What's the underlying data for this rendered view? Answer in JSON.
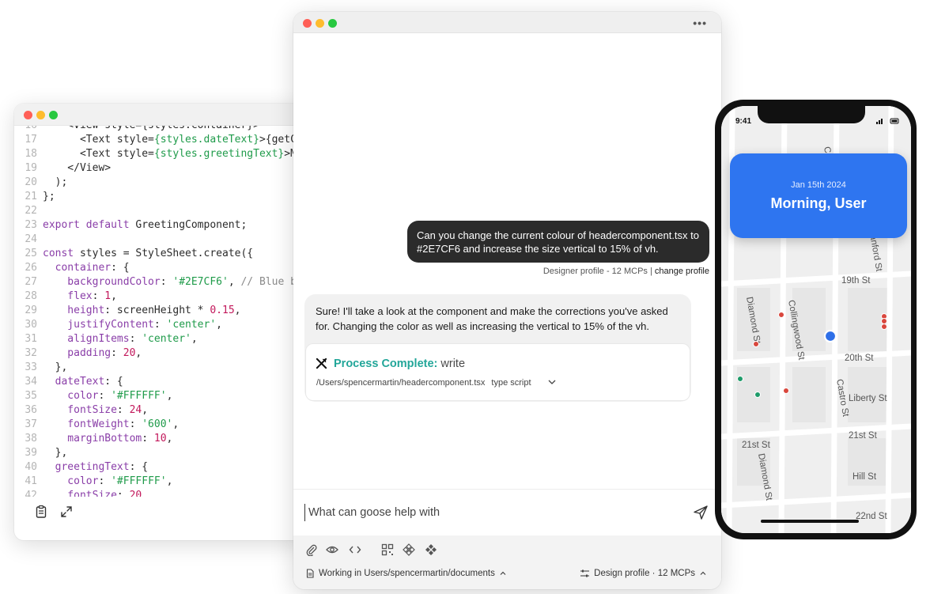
{
  "editor": {
    "lines": [
      {
        "n": "16",
        "segs": [
          [
            "txt",
            "    <View style={styles.container}>"
          ]
        ]
      },
      {
        "n": "17",
        "segs": [
          [
            "txt",
            "      <Text style="
          ],
          [
            "t-str",
            "{styles.dateText}"
          ],
          [
            "txt",
            ">{getC"
          ]
        ]
      },
      {
        "n": "18",
        "segs": [
          [
            "txt",
            "      <Text style="
          ],
          [
            "t-str",
            "{styles.greetingText}"
          ],
          [
            "txt",
            ">M"
          ]
        ]
      },
      {
        "n": "19",
        "segs": [
          [
            "txt",
            "    </View>"
          ]
        ]
      },
      {
        "n": "20",
        "segs": [
          [
            "txt",
            "  );"
          ]
        ]
      },
      {
        "n": "21",
        "segs": [
          [
            "txt",
            "};"
          ]
        ]
      },
      {
        "n": "22",
        "segs": [
          [
            "txt",
            ""
          ]
        ]
      },
      {
        "n": "23",
        "segs": [
          [
            "t-kw",
            "export default "
          ],
          [
            "txt",
            "GreetingComponent;"
          ]
        ]
      },
      {
        "n": "24",
        "segs": [
          [
            "txt",
            ""
          ]
        ]
      },
      {
        "n": "25",
        "segs": [
          [
            "t-kw",
            "const "
          ],
          [
            "txt",
            "styles = StyleSheet.create({"
          ]
        ]
      },
      {
        "n": "26",
        "segs": [
          [
            "t-prop",
            "  container"
          ],
          [
            "txt",
            ": {"
          ]
        ]
      },
      {
        "n": "27",
        "segs": [
          [
            "t-prop",
            "    backgroundColor"
          ],
          [
            "txt",
            ": "
          ],
          [
            "t-str",
            "'#2E7CF6'"
          ],
          [
            "txt",
            ", "
          ],
          [
            "t-cm",
            "// Blue b"
          ]
        ]
      },
      {
        "n": "28",
        "segs": [
          [
            "t-prop",
            "    flex"
          ],
          [
            "txt",
            ": "
          ],
          [
            "t-num",
            "1"
          ],
          [
            "txt",
            ","
          ]
        ]
      },
      {
        "n": "29",
        "segs": [
          [
            "t-prop",
            "    height"
          ],
          [
            "txt",
            ": screenHeight * "
          ],
          [
            "t-num",
            "0.15"
          ],
          [
            "txt",
            ","
          ]
        ]
      },
      {
        "n": "30",
        "segs": [
          [
            "t-prop",
            "    justifyContent"
          ],
          [
            "txt",
            ": "
          ],
          [
            "t-str",
            "'center'"
          ],
          [
            "txt",
            ","
          ]
        ]
      },
      {
        "n": "31",
        "segs": [
          [
            "t-prop",
            "    alignItems"
          ],
          [
            "txt",
            ": "
          ],
          [
            "t-str",
            "'center'"
          ],
          [
            "txt",
            ","
          ]
        ]
      },
      {
        "n": "32",
        "segs": [
          [
            "t-prop",
            "    padding"
          ],
          [
            "txt",
            ": "
          ],
          [
            "t-num",
            "20"
          ],
          [
            "txt",
            ","
          ]
        ]
      },
      {
        "n": "33",
        "segs": [
          [
            "txt",
            "  },"
          ]
        ]
      },
      {
        "n": "34",
        "segs": [
          [
            "t-prop",
            "  dateText"
          ],
          [
            "txt",
            ": {"
          ]
        ]
      },
      {
        "n": "35",
        "segs": [
          [
            "t-prop",
            "    color"
          ],
          [
            "txt",
            ": "
          ],
          [
            "t-str",
            "'#FFFFFF'"
          ],
          [
            "txt",
            ","
          ]
        ]
      },
      {
        "n": "36",
        "segs": [
          [
            "t-prop",
            "    fontSize"
          ],
          [
            "txt",
            ": "
          ],
          [
            "t-num",
            "24"
          ],
          [
            "txt",
            ","
          ]
        ]
      },
      {
        "n": "37",
        "segs": [
          [
            "t-prop",
            "    fontWeight"
          ],
          [
            "txt",
            ": "
          ],
          [
            "t-str",
            "'600'"
          ],
          [
            "txt",
            ","
          ]
        ]
      },
      {
        "n": "38",
        "segs": [
          [
            "t-prop",
            "    marginBottom"
          ],
          [
            "txt",
            ": "
          ],
          [
            "t-num",
            "10"
          ],
          [
            "txt",
            ","
          ]
        ]
      },
      {
        "n": "39",
        "segs": [
          [
            "txt",
            "  },"
          ]
        ]
      },
      {
        "n": "40",
        "segs": [
          [
            "t-prop",
            "  greetingText"
          ],
          [
            "txt",
            ": {"
          ]
        ]
      },
      {
        "n": "41",
        "segs": [
          [
            "t-prop",
            "    color"
          ],
          [
            "txt",
            ": "
          ],
          [
            "t-str",
            "'#FFFFFF'"
          ],
          [
            "txt",
            ","
          ]
        ]
      },
      {
        "n": "42",
        "segs": [
          [
            "t-prop",
            "    fontSize"
          ],
          [
            "txt",
            ": "
          ],
          [
            "t-num",
            "20"
          ],
          [
            "txt",
            ","
          ]
        ]
      }
    ],
    "footer_icons": [
      "clipboard-icon",
      "expand-icon"
    ]
  },
  "chat": {
    "user_message": "Can you change the current colour of headercomponent.tsx to #2E7CF6 and increase the size vertical to 15% of vh.",
    "meta_profile": "Designer profile - 12 MCPs |",
    "meta_link": "change profile",
    "assistant_message": "Sure! I'll take a look at the component and make the corrections you've asked for. Changing the color as well as increasing the vertical to 15% of the vh.",
    "process": {
      "title": "Process Complete:",
      "tool": "write",
      "path": "/Users/spencermartin/headercomponent.tsx",
      "type": "type script"
    },
    "input_placeholder": "What can goose help with",
    "status_left": "Working in Users/spencermartin/documents",
    "status_right": "Design profile · 12 MCPs",
    "accent_color": "#22a699"
  },
  "phone": {
    "time": "9:41",
    "header_date": "Jan 15th 2024",
    "header_greeting": "Morning, User",
    "header_color": "#2e75f0",
    "streets": [
      "Castro St",
      "Sanford St",
      "19th St",
      "Diamond St",
      "Collingwood St",
      "20th St",
      "Castro St",
      "Liberty St",
      "21st St",
      "21st St",
      "Diamond St",
      "Hill St",
      "22nd St"
    ]
  }
}
